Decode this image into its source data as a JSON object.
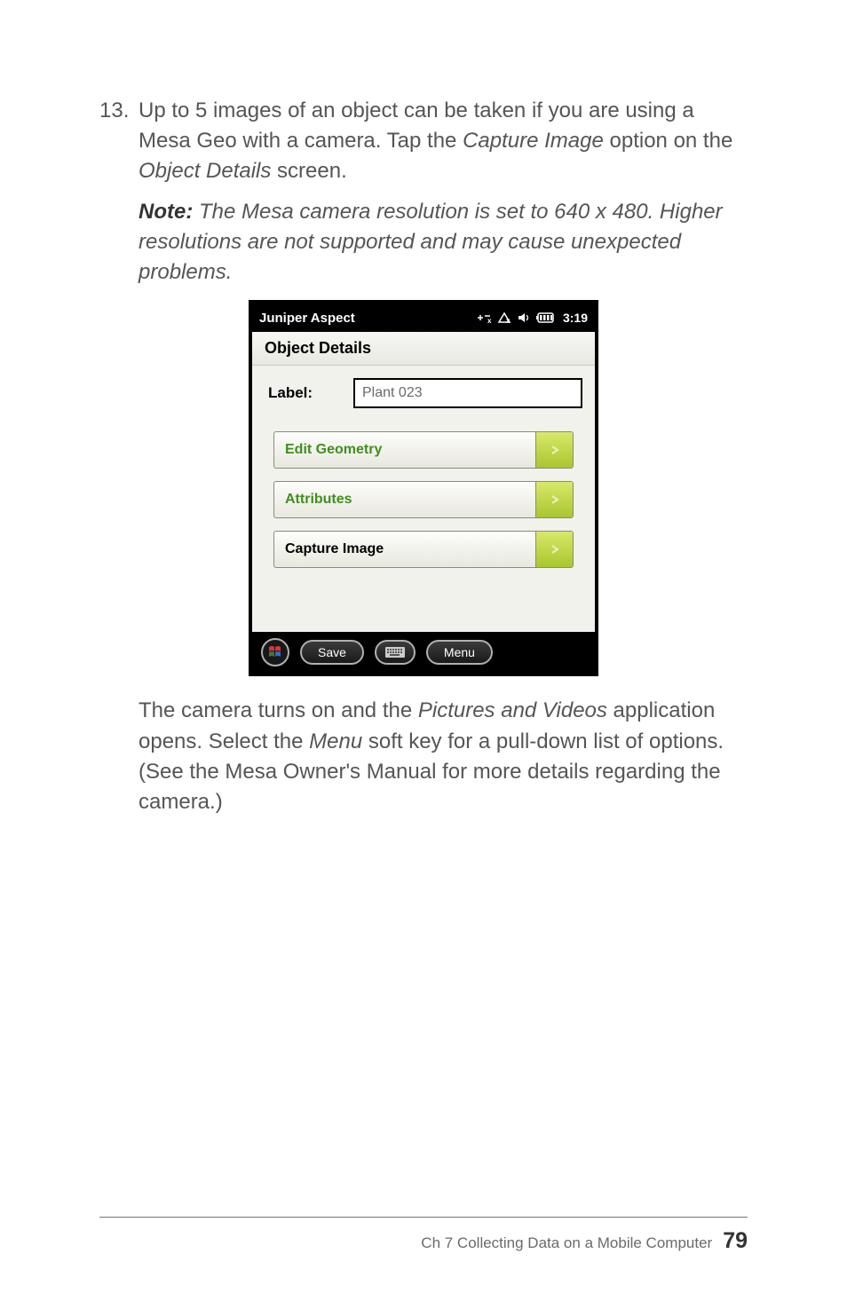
{
  "list_number": "13.",
  "para1_a": "Up to 5 images of an object can be taken if  you are using a Mesa Geo with a camera. Tap the ",
  "para1_b": "Capture Image",
  "para1_c": " option on the ",
  "para1_d": "Object Details",
  "para1_e": " screen.",
  "note_label": "Note:",
  "note_body": " The Mesa camera resolution is set to 640 x 480. Higher resolutions are not supported and may cause unexpected problems.",
  "device": {
    "title": "Juniper Aspect",
    "clock": "3:19",
    "subheader": "Object Details",
    "label_caption": "Label:",
    "label_value": "Plant 023",
    "btn_edit": "Edit Geometry",
    "btn_attr": "Attributes",
    "btn_capture": "Capture Image",
    "soft_save": "Save",
    "soft_menu": "Menu"
  },
  "para2_a": "The camera turns on and the ",
  "para2_b": "Pictures and Videos",
  "para2_c": " application opens. Select the ",
  "para2_d": "Menu",
  "para2_e": " soft key for a pull-down list of options. (See the Mesa Owner's Manual for more details regarding the camera.)",
  "footer_text": "Ch 7    Collecting Data on a Mobile Computer",
  "page_number": "79"
}
